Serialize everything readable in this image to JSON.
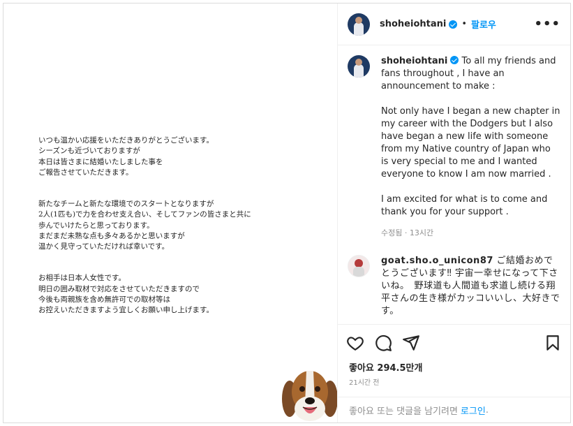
{
  "letter": {
    "lines_p1": "いつも温かい応援をいただきありがとうございます。\nシーズンも近づいておりますが\n本日は皆さまに結婚いたしました事を\nご報告させていただきます。",
    "lines_p2": "新たなチームと新たな環境でのスタートとなりますが\n2人(1匹も)で力を合わせ支え合い、そしてファンの皆さまと共に\n歩んでいけたらと思っております。\nまだまだ未熟な点も多々あるかと思いますが\n温かく見守っていただければ幸いです。",
    "lines_p3": "お相手は日本人女性です。\n明日の囲み取材で対応をさせていただきますので\n今後も両親族を含め無許可での取材等は\nお控えいただきますよう宜しくお願い申し上げます。"
  },
  "header": {
    "username": "shoheiohtani",
    "separator": "•",
    "follow_label": "팔로우",
    "more_label": "•••"
  },
  "caption": {
    "username": "shoheiohtani",
    "p1": " To all my friends and fans throughout , I have an announcement to make :",
    "p2": "Not only have I began a new chapter in my career with the Dodgers but I also have began a new life with someone from my Native country of Japan who is very special to me and I wanted everyone to know I am now married .",
    "p3": "I am excited for what is to come and thank you for your support .",
    "meta": "수정됨 · 13시간"
  },
  "comment": {
    "username": "goat.sho.o_unicon87",
    "text": " ご結婚おめでとうございます‼︎ 宇宙一幸せになって下さいね。　野球道も人間道も求道し続ける翔平さんの生き様がカッコいいし、大好きです。"
  },
  "footer": {
    "likes": "좋아요 294.5만개",
    "time": "21시간 전",
    "login_prompt": "좋아요 또는 댓글을 남기려면",
    "login_link": "로그인",
    "login_suffix": "."
  },
  "icons": [
    "heart-icon",
    "comment-icon",
    "share-icon",
    "bookmark-icon",
    "verified-icon",
    "more-icon"
  ],
  "colors": {
    "accent": "#0095f6",
    "text": "#262626",
    "muted": "#8e8e8e"
  }
}
